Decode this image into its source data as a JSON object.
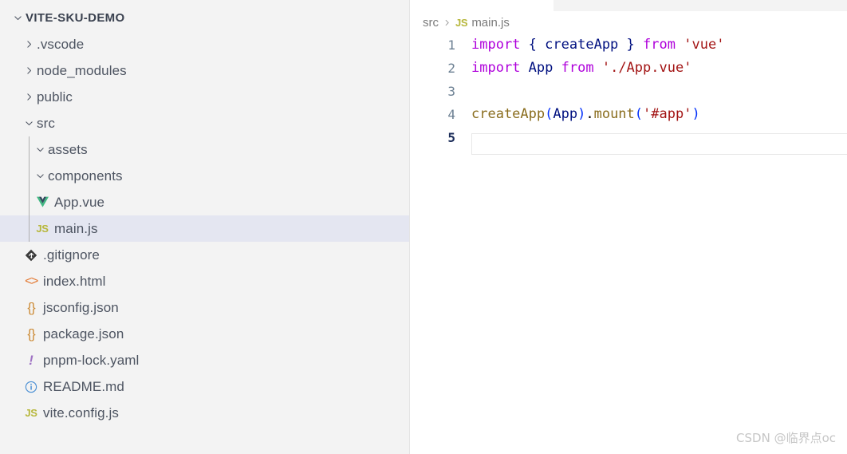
{
  "sidebar": {
    "root": {
      "label": "VITE-SKU-DEMO",
      "twisty": "chevron-down-icon",
      "expanded": true
    },
    "items": [
      {
        "label": ".vscode",
        "kind": "folder",
        "twisty": "chevron-right-icon",
        "indent": 1,
        "expanded": false
      },
      {
        "label": "node_modules",
        "kind": "folder",
        "twisty": "chevron-right-icon",
        "indent": 1,
        "expanded": false
      },
      {
        "label": "public",
        "kind": "folder",
        "twisty": "chevron-right-icon",
        "indent": 1,
        "expanded": false
      },
      {
        "label": "src",
        "kind": "folder",
        "twisty": "chevron-down-icon",
        "indent": 1,
        "expanded": true
      },
      {
        "label": "assets",
        "kind": "folder",
        "twisty": "chevron-down-icon",
        "indent": 2,
        "expanded": true
      },
      {
        "label": "components",
        "kind": "folder",
        "twisty": "chevron-down-icon",
        "indent": 2,
        "expanded": true
      },
      {
        "label": "App.vue",
        "kind": "file",
        "icon": "vue-file-icon",
        "indent": 2,
        "selected": false
      },
      {
        "label": "main.js",
        "kind": "file",
        "icon": "js-file-icon",
        "indent": 2,
        "selected": true
      },
      {
        "label": ".gitignore",
        "kind": "file",
        "icon": "git-file-icon",
        "indent": 1,
        "selected": false
      },
      {
        "label": "index.html",
        "kind": "file",
        "icon": "html-file-icon",
        "indent": 1,
        "selected": false
      },
      {
        "label": "jsconfig.json",
        "kind": "file",
        "icon": "json-file-icon",
        "indent": 1,
        "selected": false
      },
      {
        "label": "package.json",
        "kind": "file",
        "icon": "json-file-icon",
        "indent": 1,
        "selected": false
      },
      {
        "label": "pnpm-lock.yaml",
        "kind": "file",
        "icon": "yaml-file-icon",
        "indent": 1,
        "selected": false
      },
      {
        "label": "README.md",
        "kind": "file",
        "icon": "markdown-info-icon",
        "indent": 1,
        "selected": false
      },
      {
        "label": "vite.config.js",
        "kind": "file",
        "icon": "js-file-icon",
        "indent": 1,
        "selected": false
      }
    ]
  },
  "editor": {
    "breadcrumb": {
      "folder": "src",
      "separator": "chevron-right-icon",
      "file_icon": "js-file-icon",
      "file": "main.js"
    },
    "active_line": 5,
    "lines": [
      {
        "number": "1",
        "tokens": [
          {
            "t": "import",
            "c": "kw"
          },
          {
            "t": " ",
            "c": "plain"
          },
          {
            "t": "{",
            "c": "id"
          },
          {
            "t": " ",
            "c": "plain"
          },
          {
            "t": "createApp",
            "c": "id"
          },
          {
            "t": " ",
            "c": "plain"
          },
          {
            "t": "}",
            "c": "id"
          },
          {
            "t": " ",
            "c": "plain"
          },
          {
            "t": "from",
            "c": "kw"
          },
          {
            "t": " ",
            "c": "plain"
          },
          {
            "t": "'vue'",
            "c": "str"
          }
        ]
      },
      {
        "number": "2",
        "tokens": [
          {
            "t": "import",
            "c": "kw"
          },
          {
            "t": " ",
            "c": "plain"
          },
          {
            "t": "App",
            "c": "id"
          },
          {
            "t": " ",
            "c": "plain"
          },
          {
            "t": "from",
            "c": "kw"
          },
          {
            "t": " ",
            "c": "plain"
          },
          {
            "t": "'./App.vue'",
            "c": "str"
          }
        ]
      },
      {
        "number": "3",
        "tokens": []
      },
      {
        "number": "4",
        "tokens": [
          {
            "t": "createApp",
            "c": "fn"
          },
          {
            "t": "(",
            "c": "brk1"
          },
          {
            "t": "App",
            "c": "id"
          },
          {
            "t": ")",
            "c": "brk1"
          },
          {
            "t": ".",
            "c": "pun"
          },
          {
            "t": "mount",
            "c": "fn"
          },
          {
            "t": "(",
            "c": "brk1"
          },
          {
            "t": "'#app'",
            "c": "str"
          },
          {
            "t": ")",
            "c": "brk1"
          }
        ]
      },
      {
        "number": "5",
        "tokens": []
      }
    ]
  },
  "watermark": {
    "text": "CSDN @临界点oc"
  },
  "colors": {
    "sidebar_bg": "#f3f3f3",
    "editor_bg": "#ffffff",
    "selection_bg": "#e4e6f1",
    "keyword": "#af00db",
    "identifier": "#001080",
    "string": "#a31515",
    "function": "#8a6d1e",
    "bracket": "#0431fa",
    "js_icon": "#b7b73b",
    "json_icon": "#cc8b36",
    "html_icon": "#e37933",
    "yaml_icon": "#a074c4",
    "md_icon": "#4a8fd4",
    "vue_icon": "#41b883"
  }
}
